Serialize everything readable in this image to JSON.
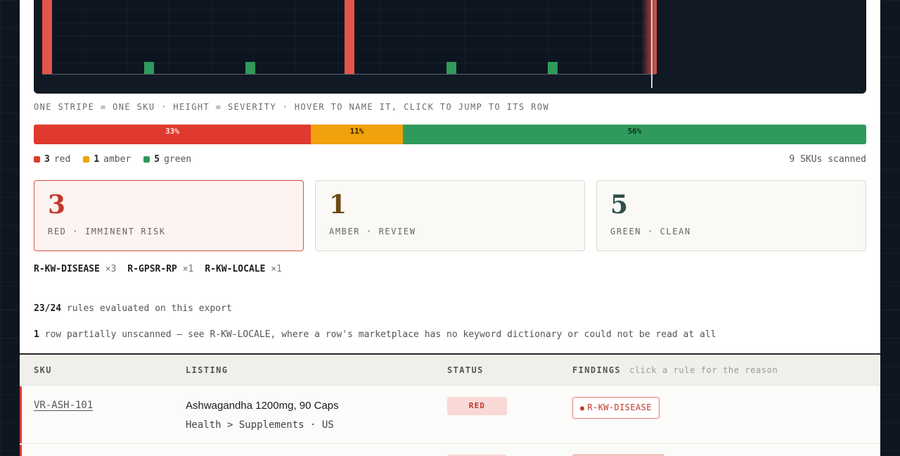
{
  "plot": {
    "caption": "ONE STRIPE = ONE SKU · HEIGHT = SEVERITY · HOVER TO NAME IT, CLICK TO JUMP TO ITS ROW",
    "stripes": [
      {
        "status": "red",
        "severity": 1.0
      },
      {
        "status": "green",
        "severity": 0.15
      },
      {
        "status": "green",
        "severity": 0.15
      },
      {
        "status": "red",
        "severity": 1.0
      },
      {
        "status": "green",
        "severity": 0.15
      },
      {
        "status": "green",
        "severity": 0.15
      },
      {
        "status": "red",
        "severity": 1.0
      }
    ]
  },
  "distribution": {
    "red_pct": "33%",
    "amber_pct": "11%",
    "green_pct": "56%",
    "red_frac": 0.333,
    "amber_frac": 0.111,
    "green_frac": 0.556
  },
  "legend": {
    "red_count": "3",
    "red_label": "red",
    "amber_count": "1",
    "amber_label": "amber",
    "green_count": "5",
    "green_label": "green",
    "scanned": "9 SKUs scanned"
  },
  "cards": [
    {
      "num": "3",
      "label": "RED · IMMINENT RISK",
      "color": "#c0392b"
    },
    {
      "num": "1",
      "label": "AMBER · REVIEW",
      "color": "#6b4a14"
    },
    {
      "num": "5",
      "label": "GREEN · CLEAN",
      "color": "#2e4f4a"
    }
  ],
  "rule_counts": [
    {
      "rule": "R-KW-DISEASE",
      "count": "×3"
    },
    {
      "rule": "R-GPSR-RP",
      "count": "×1"
    },
    {
      "rule": "R-KW-LOCALE",
      "count": "×1"
    }
  ],
  "evaluated": {
    "count": "23/24",
    "text": "rules evaluated on this export"
  },
  "partial": {
    "count": "1",
    "text": "row partially unscanned — see R-KW-LOCALE, where a row's marketplace has no keyword dictionary or could not be read at all"
  },
  "table": {
    "headers": {
      "sku": "SKU",
      "listing": "LISTING",
      "status": "STATUS",
      "findings": "FINDINGS",
      "findings_hint": "click a rule for the reason"
    },
    "rows": [
      {
        "sku": "VR-ASH-101",
        "title": "Ashwagandha 1200mg, 90 Caps",
        "meta": "Health > Supplements · US",
        "status": "RED",
        "finding": "R-KW-DISEASE"
      }
    ]
  },
  "colors": {
    "red": "#e03a2e",
    "amber": "#f0a10b",
    "green": "#2f9a5c"
  }
}
